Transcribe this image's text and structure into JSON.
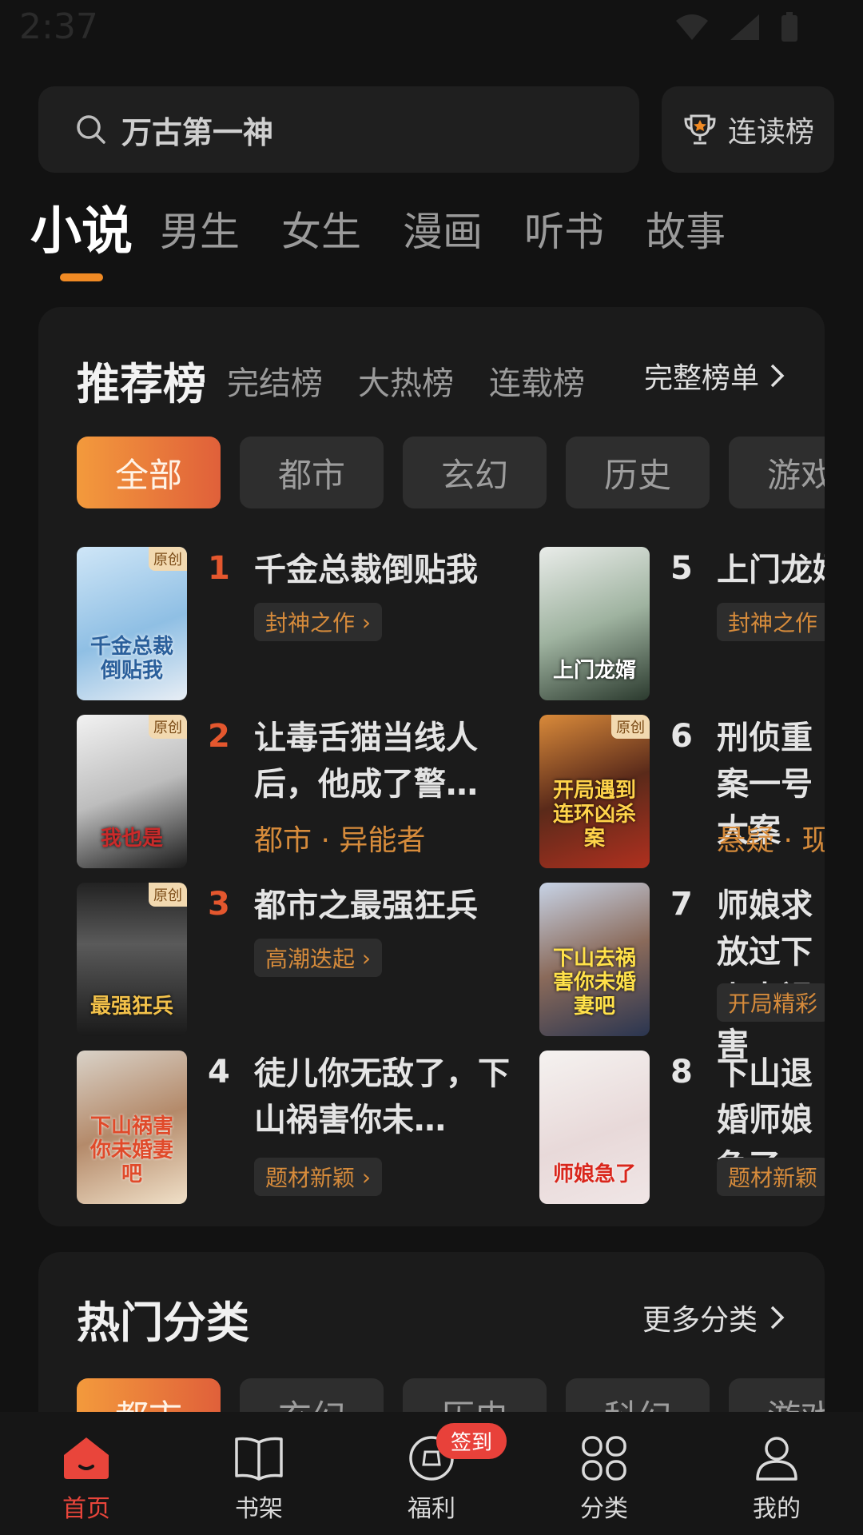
{
  "status_bar": {
    "time": "2:37"
  },
  "search": {
    "text": "万古第一神"
  },
  "rank_button": {
    "label": "连读榜"
  },
  "main_tabs": [
    "小说",
    "男生",
    "女生",
    "漫画",
    "听书",
    "故事"
  ],
  "ranking": {
    "tabs": [
      "推荐榜",
      "完结榜",
      "大热榜",
      "连载榜"
    ],
    "full_label": "完整榜单",
    "chips": [
      "全部",
      "都市",
      "玄幻",
      "历史",
      "游戏"
    ],
    "books": [
      {
        "rank": "1",
        "title": "千金总裁倒贴我",
        "tag": "封神之作",
        "badge": "原创",
        "cover_text": "千金总裁倒贴我"
      },
      {
        "rank": "2",
        "title": "让毒舌猫当线人后，他成了警…",
        "tag": "都市 · 异能者",
        "badge": "原创",
        "cover_text": "我也是"
      },
      {
        "rank": "3",
        "title": "都市之最强狂兵",
        "tag": "高潮迭起",
        "badge": "原创",
        "cover_text": "最强狂兵"
      },
      {
        "rank": "4",
        "title": "徒儿你无敌了，下山祸害你未…",
        "tag": "题材新颖",
        "badge": "",
        "cover_text": "下山祸害你未婚妻吧"
      },
      {
        "rank": "5",
        "title": "上门龙婿",
        "tag": "封神之作",
        "badge": "",
        "cover_text": "上门龙婿"
      },
      {
        "rank": "6",
        "title": "刑侦重案一号大案",
        "tag": "悬疑 · 现",
        "badge": "原创",
        "cover_text": "开局遇到连环凶杀案"
      },
      {
        "rank": "7",
        "title": "师娘求放过下山去祸害",
        "tag": "开局精彩",
        "badge": "",
        "cover_text": "下山去祸害你未婚妻吧"
      },
      {
        "rank": "8",
        "title": "下山退婚师娘急了",
        "tag": "题材新颖",
        "badge": "",
        "cover_text": "师娘急了"
      }
    ]
  },
  "hot_categories": {
    "title": "热门分类",
    "more_label": "更多分类",
    "chips": [
      "都市",
      "玄幻",
      "历史",
      "科幻",
      "游戏"
    ]
  },
  "bottom_nav": {
    "items": [
      "首页",
      "书架",
      "福利",
      "分类",
      "我的"
    ],
    "sign_badge": "签到"
  },
  "colors": {
    "accent": "#f08a24",
    "hot_rank": "#e4572e",
    "tag_text": "#d68b3b",
    "nav_active": "#e9453b"
  }
}
